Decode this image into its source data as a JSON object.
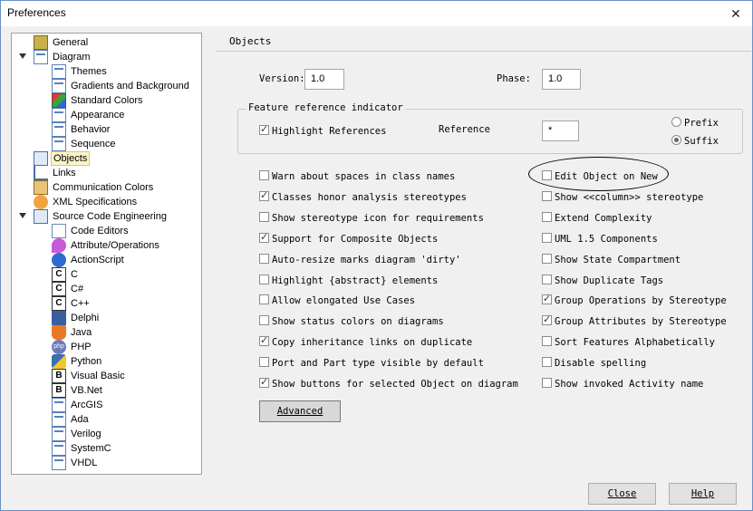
{
  "window": {
    "title": "Preferences"
  },
  "tree": [
    {
      "label": "General",
      "icon": "general-icon"
    },
    {
      "label": "Diagram",
      "icon": "diagram-icon",
      "expanded": true
    },
    {
      "label": "Themes",
      "icon": "page-icon"
    },
    {
      "label": "Gradients and Background",
      "icon": "page-icon"
    },
    {
      "label": "Standard Colors",
      "icon": "colors-icon"
    },
    {
      "label": "Appearance",
      "icon": "page-icon"
    },
    {
      "label": "Behavior",
      "icon": "page-icon"
    },
    {
      "label": "Sequence",
      "icon": "page-icon"
    },
    {
      "label": "Objects",
      "icon": "objects-icon",
      "selected": true
    },
    {
      "label": "Links",
      "icon": "links-icon"
    },
    {
      "label": "Communication Colors",
      "icon": "communication-icon"
    },
    {
      "label": "XML Specifications",
      "icon": "xml-icon"
    },
    {
      "label": "Source Code Engineering",
      "icon": "source-code-icon",
      "expanded": true
    },
    {
      "label": "Code Editors",
      "icon": "editor-icon"
    },
    {
      "label": "Attribute/Operations",
      "icon": "attribute-icon"
    },
    {
      "label": "ActionScript",
      "icon": "actionscript-icon"
    },
    {
      "label": "C",
      "icon": "c-icon",
      "glyph": "C"
    },
    {
      "label": "C#",
      "icon": "csharp-icon",
      "glyph": "C"
    },
    {
      "label": "C++",
      "icon": "cpp-icon",
      "glyph": "C"
    },
    {
      "label": "Delphi",
      "icon": "delphi-icon"
    },
    {
      "label": "Java",
      "icon": "java-icon"
    },
    {
      "label": "PHP",
      "icon": "php-icon",
      "glyph": "php"
    },
    {
      "label": "Python",
      "icon": "python-icon"
    },
    {
      "label": "Visual Basic",
      "icon": "vb-icon",
      "glyph": "B"
    },
    {
      "label": "VB.Net",
      "icon": "vbnet-icon",
      "glyph": "B"
    },
    {
      "label": "ArcGIS",
      "icon": "page-icon"
    },
    {
      "label": "Ada",
      "icon": "page-icon"
    },
    {
      "label": "Verilog",
      "icon": "page-icon"
    },
    {
      "label": "SystemC",
      "icon": "page-icon"
    },
    {
      "label": "VHDL",
      "icon": "page-icon"
    }
  ],
  "panel": {
    "header": "Objects",
    "version_label": "Version:",
    "version_value": "1.0",
    "phase_label": "Phase:",
    "phase_value": "1.0",
    "feature_group": "Feature reference indicator",
    "highlight_label": "Highlight References",
    "highlight_checked": true,
    "reference_label": "Reference",
    "reference_value": "*",
    "prefix_label": "Prefix",
    "suffix_label": "Suffix",
    "suffix_selected": true
  },
  "left_options": [
    {
      "label": "Warn about spaces in class names",
      "checked": false
    },
    {
      "label": "Classes honor analysis stereotypes",
      "checked": true
    },
    {
      "label": "Show stereotype icon for requirements",
      "checked": false
    },
    {
      "label": "Support for Composite Objects",
      "checked": true
    },
    {
      "label": "Auto-resize marks diagram 'dirty'",
      "checked": false
    },
    {
      "label": "Highlight {abstract} elements",
      "checked": false
    },
    {
      "label": "Allow elongated Use Cases",
      "checked": false
    },
    {
      "label": "Show status colors on diagrams",
      "checked": false
    },
    {
      "label": "Copy inheritance links on duplicate",
      "checked": true
    },
    {
      "label": "Port and Part type visible by default",
      "checked": false
    },
    {
      "label": "Show buttons for selected Object on diagram",
      "checked": true
    }
  ],
  "right_options": [
    {
      "label": "Edit Object on New",
      "checked": false
    },
    {
      "label": "Show <<column>> stereotype",
      "checked": false
    },
    {
      "label": "Extend Complexity",
      "checked": false
    },
    {
      "label": "UML 1.5 Components",
      "checked": false
    },
    {
      "label": "Show State Compartment",
      "checked": false
    },
    {
      "label": "Show Duplicate Tags",
      "checked": false
    },
    {
      "label": "Group Operations by Stereotype",
      "checked": true
    },
    {
      "label": "Group Attributes by Stereotype",
      "checked": true
    },
    {
      "label": "Sort Features Alphabetically",
      "checked": false
    },
    {
      "label": "Disable spelling",
      "checked": false
    },
    {
      "label": "Show invoked Activity name",
      "checked": false
    }
  ],
  "buttons": {
    "advanced": "Advanced",
    "close": "Close",
    "help": "Help"
  }
}
